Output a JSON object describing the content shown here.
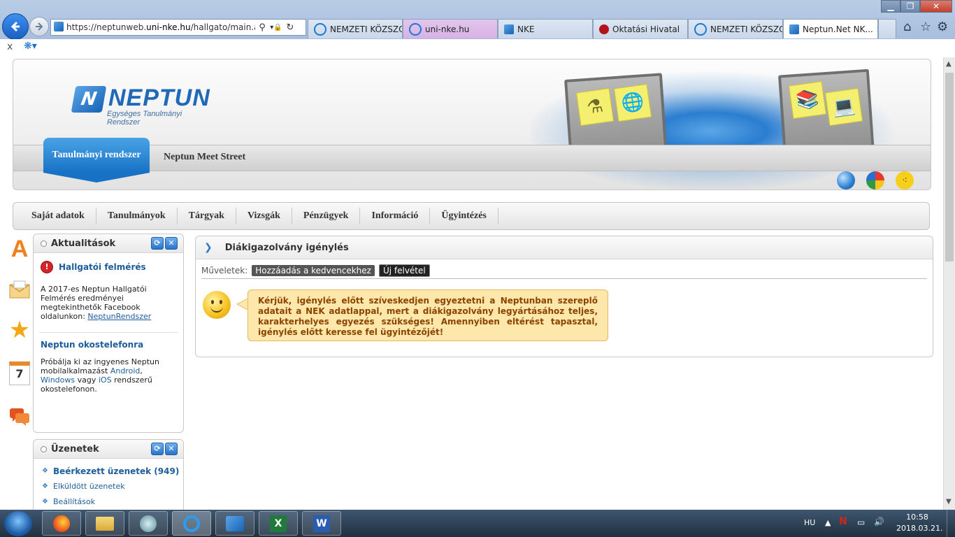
{
  "browser": {
    "url_prefix": "https://neptunweb.",
    "url_domain": "uni-nke.hu",
    "url_path": "/hallgato/main.aspx?",
    "search_icon": "search-icon",
    "tabs": [
      {
        "label": "NEMZETI KÖZSZO..."
      },
      {
        "label": "uni-nke.hu"
      },
      {
        "label": "NKE"
      },
      {
        "label": "Oktatási Hivatal"
      },
      {
        "label": "NEMZETI KÖZSZO..."
      },
      {
        "label": "Neptun.Net NK..."
      }
    ],
    "cmdbar_close": "x"
  },
  "header": {
    "logo_name": "NEPTUN",
    "logo_sub": "Egységes Tanulmányi Rendszer",
    "tab_active": "Tanulmányi rendszer",
    "tab_meet": "Neptun Meet Street"
  },
  "menu": [
    "Saját adatok",
    "Tanulmányok",
    "Tárgyak",
    "Vizsgák",
    "Pénzügyek",
    "Információ",
    "Ügyintézés"
  ],
  "news_box": {
    "title": "Aktualitások",
    "item1_title": "Hallgatói felmérés",
    "item1_text": "A 2017-es Neptun Hallgatói Felmérés eredményei megtekinthetők Facebook oldalunkon:",
    "item1_link": "NeptunRendszer",
    "item2_title": "Neptun okostelefonra",
    "item2_text_a": "Próbálja ki az ingyenes Neptun mobilalkalmazást",
    "item2_link_android": "Android",
    "item2_link_windows": "Windows",
    "item2_text_b": "vagy",
    "item2_link_ios": "iOS",
    "item2_text_c": "rendszerű okostelefonon."
  },
  "messages_box": {
    "title": "Üzenetek",
    "items": [
      "Beérkezett üzenetek (949)",
      "Elküldött üzenetek",
      "Beállítások"
    ]
  },
  "main": {
    "title": "Diákigazolvány igénylés",
    "actions_label": "Műveletek:",
    "action_favorites": "Hozzáadás a kedvencekhez",
    "action_new": "Új felvétel",
    "notice": "Kérjük, igénylés előtt szíveskedjen egyeztetni a Neptunban szereplő adatait a NEK adatlappal, mert a diákigazolvány legyártásához teljes, karakterhelyes egyezés szükséges! Amennyiben eltérést tapasztal, igénylés előtt keresse fel ügyintézőjét!"
  },
  "side_icons": {
    "calendar_day": "7"
  },
  "tray": {
    "lang": "HU",
    "time": "10:58",
    "date": "2018.03.21."
  },
  "colors": {
    "accent": "#1f69b8",
    "link": "#1d5d9c",
    "notice_bg": "#fde7aa",
    "notice_text": "#8c4400"
  }
}
